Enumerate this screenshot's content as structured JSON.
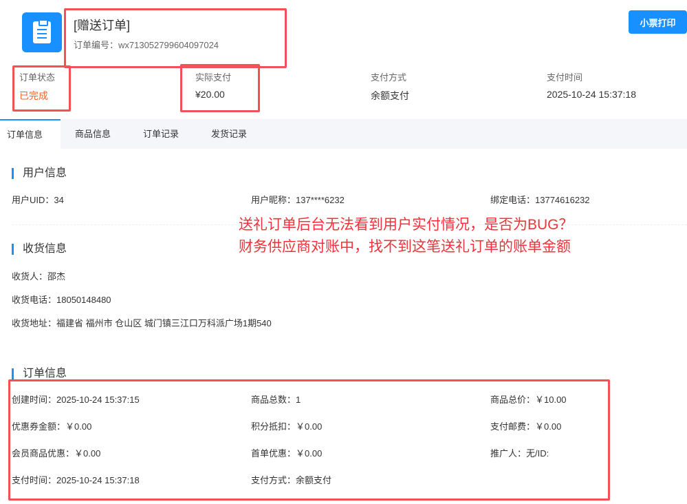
{
  "header": {
    "title": "[赠送订单]",
    "order_no": "订单编号：wx713052799604097024",
    "print_button": "小票打印"
  },
  "stats": [
    {
      "label": "订单状态",
      "value": "已完成"
    },
    {
      "label": "实际支付",
      "value": "¥20.00"
    },
    {
      "label": "支付方式",
      "value": "余额支付"
    },
    {
      "label": "支付时间",
      "value": "2025-10-24 15:37:18"
    }
  ],
  "tabs": [
    "订单信息",
    "商品信息",
    "订单记录",
    "发货记录"
  ],
  "user_section": {
    "title": "用户信息",
    "uid": "用户UID：34",
    "nickname": "用户昵称：137****6232",
    "phone": "绑定电话：13774616232"
  },
  "annotation": {
    "line1": "送礼订单后台无法看到用户实付情况，是否为BUG？",
    "line2": "财务供应商对账中，找不到这笔送礼订单的账单金额"
  },
  "shipping_section": {
    "title": "收货信息",
    "receiver": "收货人：邵杰",
    "phone": "收货电话：18050148480",
    "address": "收货地址：福建省 福州市 仓山区 城门镇三江口万科派广场1期540"
  },
  "order_section": {
    "title": "订单信息",
    "rows": [
      [
        "创建时间：2025-10-24 15:37:15",
        "商品总数：1",
        "商品总价：￥10.00"
      ],
      [
        "优惠券金额：￥0.00",
        "积分抵扣：￥0.00",
        "支付邮费：￥0.00"
      ],
      [
        "会员商品优惠：￥0.00",
        "首单优惠：￥0.00",
        "推广人：无/ID:"
      ],
      [
        "支付时间：2025-10-24 15:37:18",
        "支付方式：余额支付",
        ""
      ]
    ]
  },
  "colors": {
    "accent": "#1890ff",
    "status": "#f5632a",
    "annotation": "#f0323a"
  }
}
